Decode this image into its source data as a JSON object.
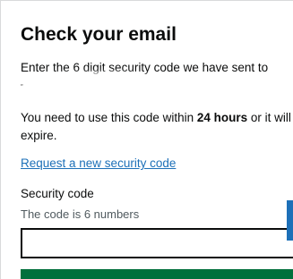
{
  "page": {
    "heading": "Check your email",
    "intro": "Enter the 6 digit security code we have sent to",
    "warning": {
      "before": "You need to use this code within ",
      "emphasis": "24 hours",
      "after": " or it will expire."
    },
    "resend_link": "Request a new security code"
  },
  "form": {
    "code_label": "Security code",
    "code_hint": "The code is 6 numbers",
    "code_value": ""
  },
  "colors": {
    "text": "#0b0c0c",
    "link": "#1d70b8",
    "hint": "#505a5f",
    "button": "#00703c"
  }
}
